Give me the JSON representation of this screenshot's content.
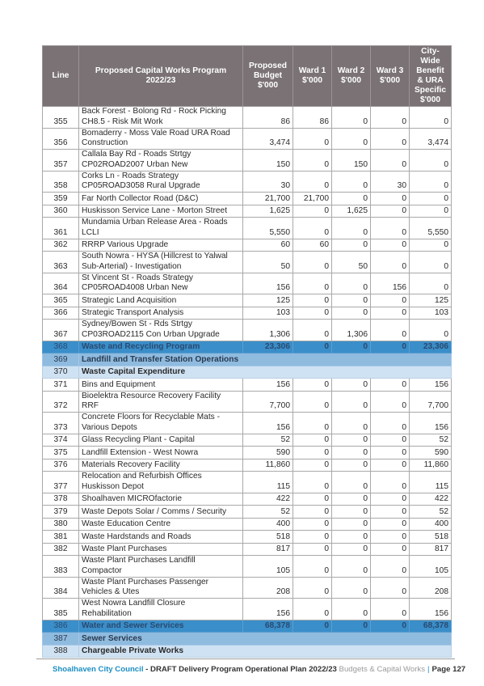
{
  "table": {
    "headers": {
      "line": "Line",
      "program": [
        "Proposed Capital Works Program",
        "2022/23"
      ],
      "budget": [
        "Proposed",
        "Budget",
        "$'000"
      ],
      "ward1": [
        "Ward 1",
        "$'000"
      ],
      "ward2": [
        "Ward 2",
        "$'000"
      ],
      "ward3": [
        "Ward 3",
        "$'000"
      ],
      "citywide": [
        "City-",
        "Wide",
        "Benefit",
        "& URA",
        "Specific",
        "$'000"
      ]
    },
    "rows": [
      {
        "line": "355",
        "desc": [
          "Back Forest - Bolong Rd - Rock Picking",
          "CH8.5 - Risk Mit Work"
        ],
        "budget": "86",
        "ward1": "86",
        "ward2": "0",
        "ward3": "0",
        "citywide": "0",
        "type": "item"
      },
      {
        "line": "356",
        "desc": [
          "Bomaderry - Moss Vale Road URA Road",
          "Construction"
        ],
        "budget": "3,474",
        "ward1": "0",
        "ward2": "0",
        "ward3": "0",
        "citywide": "3,474",
        "type": "item"
      },
      {
        "line": "357",
        "desc": [
          "Callala Bay Rd - Roads Strtgy",
          "CP02ROAD2007  Urban New"
        ],
        "budget": "150",
        "ward1": "0",
        "ward2": "150",
        "ward3": "0",
        "citywide": "0",
        "type": "item"
      },
      {
        "line": "358",
        "desc": [
          "Corks Ln - Roads Strategy",
          "CP05ROAD3058  Rural Upgrade"
        ],
        "budget": "30",
        "ward1": "0",
        "ward2": "0",
        "ward3": "30",
        "citywide": "0",
        "type": "item"
      },
      {
        "line": "359",
        "desc": [
          "Far North Collector Road (D&C)"
        ],
        "budget": "21,700",
        "ward1": "21,700",
        "ward2": "0",
        "ward3": "0",
        "citywide": "0",
        "type": "item"
      },
      {
        "line": "360",
        "desc": [
          "Huskisson Service Lane - Morton Street"
        ],
        "budget": "1,625",
        "ward1": "0",
        "ward2": "1,625",
        "ward3": "0",
        "citywide": "0",
        "type": "item"
      },
      {
        "line": "361",
        "desc": [
          "Mundamia Urban Release Area - Roads",
          "LCLI"
        ],
        "budget": "5,550",
        "ward1": "0",
        "ward2": "0",
        "ward3": "0",
        "citywide": "5,550",
        "type": "item"
      },
      {
        "line": "362",
        "desc": [
          "RRRP   Various  Upgrade"
        ],
        "budget": "60",
        "ward1": "60",
        "ward2": "0",
        "ward3": "0",
        "citywide": "0",
        "type": "item"
      },
      {
        "line": "363",
        "desc": [
          "South Nowra - HYSA (Hillcrest to Yalwal",
          "Sub-Arterial) - Investigation"
        ],
        "budget": "50",
        "ward1": "0",
        "ward2": "50",
        "ward3": "0",
        "citywide": "0",
        "type": "item"
      },
      {
        "line": "364",
        "desc": [
          "St Vincent St - Roads Strategy",
          "CP05ROAD4008  Urban New"
        ],
        "budget": "156",
        "ward1": "0",
        "ward2": "0",
        "ward3": "156",
        "citywide": "0",
        "type": "item"
      },
      {
        "line": "365",
        "desc": [
          "Strategic Land Acquisition"
        ],
        "budget": "125",
        "ward1": "0",
        "ward2": "0",
        "ward3": "0",
        "citywide": "125",
        "type": "item"
      },
      {
        "line": "366",
        "desc": [
          "Strategic Transport Analysis"
        ],
        "budget": "103",
        "ward1": "0",
        "ward2": "0",
        "ward3": "0",
        "citywide": "103",
        "type": "item"
      },
      {
        "line": "367",
        "desc": [
          "Sydney/Bowen St - Rds Strtgy",
          "CP03ROAD2115 Con Urban Upgrade"
        ],
        "budget": "1,306",
        "ward1": "0",
        "ward2": "1,306",
        "ward3": "0",
        "citywide": "0",
        "type": "item"
      },
      {
        "line": "368",
        "desc": [
          "Waste and Recycling Program"
        ],
        "budget": "23,306",
        "ward1": "0",
        "ward2": "0",
        "ward3": "0",
        "citywide": "23,306",
        "type": "program"
      },
      {
        "line": "369",
        "desc": [
          "Landfill and Transfer Station Operations"
        ],
        "type": "service"
      },
      {
        "line": "370",
        "desc": [
          "Waste Capital Expenditure"
        ],
        "type": "category"
      },
      {
        "line": "371",
        "desc": [
          "Bins and Equipment"
        ],
        "budget": "156",
        "ward1": "0",
        "ward2": "0",
        "ward3": "0",
        "citywide": "156",
        "type": "item"
      },
      {
        "line": "372",
        "desc": [
          "Bioelektra Resource Recovery Facility",
          "RRF"
        ],
        "budget": "7,700",
        "ward1": "0",
        "ward2": "0",
        "ward3": "0",
        "citywide": "7,700",
        "type": "item"
      },
      {
        "line": "373",
        "desc": [
          "Concrete Floors for Recyclable Mats -",
          "Various Depots"
        ],
        "budget": "156",
        "ward1": "0",
        "ward2": "0",
        "ward3": "0",
        "citywide": "156",
        "type": "item"
      },
      {
        "line": "374",
        "desc": [
          "Glass Recycling Plant -  Capital"
        ],
        "budget": "52",
        "ward1": "0",
        "ward2": "0",
        "ward3": "0",
        "citywide": "52",
        "type": "item"
      },
      {
        "line": "375",
        "desc": [
          "Landfill Extension - West Nowra"
        ],
        "budget": "590",
        "ward1": "0",
        "ward2": "0",
        "ward3": "0",
        "citywide": "590",
        "type": "item"
      },
      {
        "line": "376",
        "desc": [
          "Materials Recovery Facility"
        ],
        "budget": "11,860",
        "ward1": "0",
        "ward2": "0",
        "ward3": "0",
        "citywide": "11,860",
        "type": "item"
      },
      {
        "line": "377",
        "desc": [
          "Relocation and Refurbish Offices",
          "Huskisson Depot"
        ],
        "budget": "115",
        "ward1": "0",
        "ward2": "0",
        "ward3": "0",
        "citywide": "115",
        "type": "item"
      },
      {
        "line": "378",
        "desc": [
          "Shoalhaven MICROfactorie"
        ],
        "budget": "422",
        "ward1": "0",
        "ward2": "0",
        "ward3": "0",
        "citywide": "422",
        "type": "item"
      },
      {
        "line": "379",
        "desc": [
          "Waste Depots Solar / Comms / Security"
        ],
        "budget": "52",
        "ward1": "0",
        "ward2": "0",
        "ward3": "0",
        "citywide": "52",
        "type": "item"
      },
      {
        "line": "380",
        "desc": [
          "Waste Education Centre"
        ],
        "budget": "400",
        "ward1": "0",
        "ward2": "0",
        "ward3": "0",
        "citywide": "400",
        "type": "item"
      },
      {
        "line": "381",
        "desc": [
          "Waste Hardstands and Roads"
        ],
        "budget": "518",
        "ward1": "0",
        "ward2": "0",
        "ward3": "0",
        "citywide": "518",
        "type": "item"
      },
      {
        "line": "382",
        "desc": [
          "Waste Plant Purchases"
        ],
        "budget": "817",
        "ward1": "0",
        "ward2": "0",
        "ward3": "0",
        "citywide": "817",
        "type": "item"
      },
      {
        "line": "383",
        "desc": [
          "Waste Plant Purchases Landfill",
          "Compactor"
        ],
        "budget": "105",
        "ward1": "0",
        "ward2": "0",
        "ward3": "0",
        "citywide": "105",
        "type": "item"
      },
      {
        "line": "384",
        "desc": [
          "Waste Plant Purchases Passenger",
          "Vehicles & Utes"
        ],
        "budget": "208",
        "ward1": "0",
        "ward2": "0",
        "ward3": "0",
        "citywide": "208",
        "type": "item"
      },
      {
        "line": "385",
        "desc": [
          "West Nowra Landfill Closure",
          "Rehabilitation"
        ],
        "budget": "156",
        "ward1": "0",
        "ward2": "0",
        "ward3": "0",
        "citywide": "156",
        "type": "item"
      },
      {
        "line": "386",
        "desc": [
          "Water and Sewer Services"
        ],
        "budget": "68,378",
        "ward1": "0",
        "ward2": "0",
        "ward3": "0",
        "citywide": "68,378",
        "type": "program"
      },
      {
        "line": "387",
        "desc": [
          "Sewer Services"
        ],
        "type": "service"
      },
      {
        "line": "388",
        "desc": [
          "Chargeable Private Works"
        ],
        "type": "category"
      }
    ]
  },
  "footer": {
    "organisation": "Shoalhaven City Council",
    "document": " - DRAFT Delivery Program Operational Plan 2022/23 ",
    "section": "Budgets & Capital Works",
    "separator": "|",
    "page": "Page 127"
  },
  "colors": {
    "header_bg": "#7a7275",
    "program_row": "#3a8ec9",
    "service_row": "#8fbbdf",
    "category_row": "#cfe2f3",
    "footer_brand": "#1c8fc1"
  }
}
